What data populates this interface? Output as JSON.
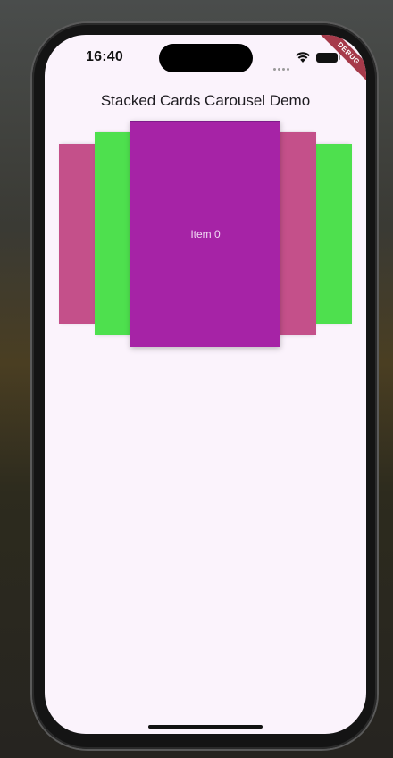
{
  "status_bar": {
    "time": "16:40",
    "signal_icon": "signal-dots-icon",
    "wifi_icon": "wifi-icon",
    "battery_icon": "battery-icon",
    "debug_banner": "DEBUG"
  },
  "app": {
    "title": "Stacked Cards Carousel Demo"
  },
  "carousel": {
    "cards": [
      {
        "position": "left-2",
        "color": "#c4508a",
        "label": ""
      },
      {
        "position": "left-1",
        "color": "#4ee04e",
        "label": ""
      },
      {
        "position": "center",
        "color": "#a623a6",
        "label": "Item 0"
      },
      {
        "position": "right-1",
        "color": "#c4508a",
        "label": ""
      },
      {
        "position": "right-2",
        "color": "#4ee04e",
        "label": ""
      }
    ]
  },
  "colors": {
    "screen_background": "#fbf3fc",
    "debug_banner": "#a63a4a"
  }
}
